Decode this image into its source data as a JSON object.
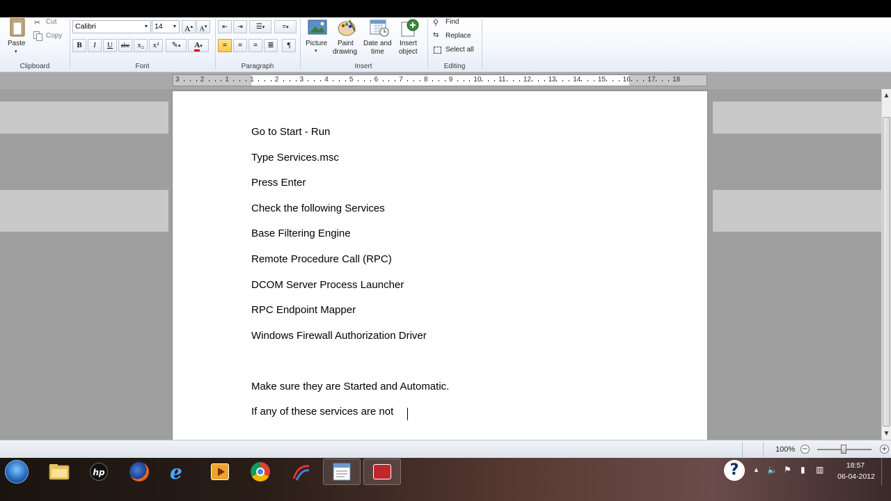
{
  "ribbon": {
    "clipboard": {
      "label": "Clipboard",
      "paste": "Paste",
      "cut": "Cut",
      "copy": "Copy"
    },
    "font": {
      "label": "Font",
      "family": "Calibri",
      "size": "14",
      "bold": "B",
      "italic": "I",
      "underline": "U",
      "strike": "abc",
      "sub": "x₂",
      "sup": "x²",
      "color_letter": "A"
    },
    "paragraph": {
      "label": "Paragraph"
    },
    "insert": {
      "label": "Insert",
      "picture": "Picture",
      "paint_drawing": [
        "Paint",
        "drawing"
      ],
      "date_time": [
        "Date and",
        "time"
      ],
      "insert_object": [
        "Insert",
        "object"
      ]
    },
    "editing": {
      "label": "Editing",
      "find": "Find",
      "replace": "Replace",
      "select_all": "Select all"
    }
  },
  "ruler": {
    "ticks": [
      "3",
      "2",
      "1",
      "1",
      "2",
      "3",
      "4",
      "5",
      "6",
      "7",
      "8",
      "9",
      "10",
      "11",
      "12",
      "13",
      "14",
      "15",
      "16",
      "17",
      "18"
    ]
  },
  "document": {
    "lines": [
      "Go to Start - Run",
      "Type Services.msc",
      "Press Enter",
      "Check the following Services",
      "Base Filtering Engine",
      "Remote Procedure Call (RPC)",
      "DCOM Server Process Launcher",
      "RPC Endpoint Mapper",
      "Windows Firewall Authorization Driver",
      "",
      "Make sure they are Started and Automatic.",
      "If any of these services are not"
    ]
  },
  "status": {
    "zoom": "100%"
  },
  "taskbar": {
    "apps": [
      "windows-explorer",
      "hp",
      "firefox",
      "internet-explorer",
      "media-player",
      "chrome",
      "app-arrow",
      "wordpad",
      "dvd-app"
    ],
    "help": "?",
    "time": "18:57",
    "date": "06-04-2012"
  },
  "colors": {
    "ribbon_top": "#ffffff",
    "ribbon_bottom": "#e6edf7",
    "workspace": "#9f9f9f",
    "accent": "#ffc84a"
  }
}
